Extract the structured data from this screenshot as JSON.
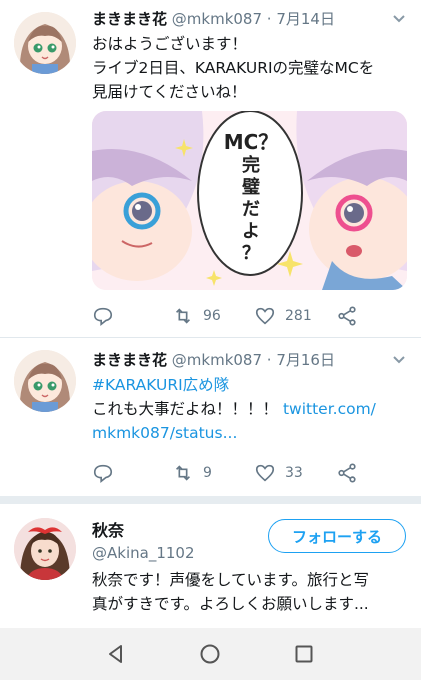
{
  "tweets": [
    {
      "name": "まきまき花",
      "handle": "@mkmk087",
      "sep": " · ",
      "date": "7月14日",
      "lines": [
        "おはようございます！",
        "ライブ2日目、KARAKURIの完璧なMCを",
        "見届けてくださいね！"
      ],
      "media": {
        "bubble_text": [
          "MC？",
          "完",
          "璧",
          "だ",
          "よ",
          "？"
        ]
      },
      "replies": "",
      "retweets": "96",
      "likes": "281"
    },
    {
      "name": "まきまき花",
      "handle": "@mkmk087",
      "sep": " · ",
      "date": "7月16日",
      "hashtag": "#KARAKURI広め隊",
      "line2_text": "これも大事だよね！！！！ ",
      "line2_link": "twitter.com/",
      "line3_link": "mkmk087/status...",
      "replies": "",
      "retweets": "9",
      "likes": "33"
    }
  ],
  "profile": {
    "name": "秋奈",
    "handle": "@Akina_1102",
    "follow_label": "フォローする",
    "bio_line1": "秋奈です！声優をしています。旅行と写",
    "bio_line2": "真がすきです。よろしくお願いします..."
  },
  "nav": {
    "back_icon": "back-triangle",
    "home_icon": "home-circle",
    "recents_icon": "recents-square"
  },
  "colors": {
    "link": "#1b95e0",
    "accent": "#1da1f2",
    "meta": "#657786"
  }
}
